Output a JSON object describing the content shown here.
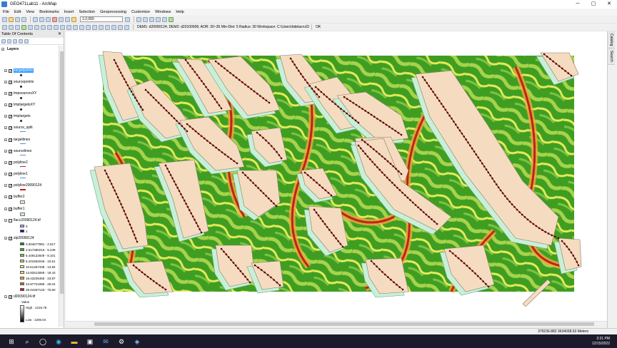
{
  "window": {
    "title": "GEO471Lab11 - ArcMap"
  },
  "menu": [
    "File",
    "Edit",
    "View",
    "Bookmarks",
    "Insert",
    "Selection",
    "Geoprocessing",
    "Customize",
    "Windows",
    "Help"
  ],
  "toolbar": {
    "scale": "1:2,060",
    "params": "DEM1: d20090124; DEM2: d20100606; AOR: 30~35 Min-Dist: 5 Radius: 30 Workspace: C:\\Users\\bdelacru\\D",
    "ok_label": "OK"
  },
  "toc": {
    "title": "Table Of Contents",
    "root": "Layers",
    "layers": [
      {
        "name": "targetpoints",
        "checked": true,
        "selected": true
      },
      {
        "name": "sourcepoints",
        "checked": true
      },
      {
        "name": "tmpsourcesXY",
        "checked": true
      },
      {
        "name": "tmptargetsXY",
        "checked": true
      },
      {
        "name": "tmptargets",
        "checked": true
      },
      {
        "name": "source_split",
        "checked": true
      },
      {
        "name": "targetlines",
        "checked": true
      },
      {
        "name": "sourcelines",
        "checked": true
      },
      {
        "name": "polyline2",
        "checked": true
      },
      {
        "name": "polyline1",
        "checked": true
      },
      {
        "name": "polyline20090124",
        "checked": true
      },
      {
        "name": "buffer2",
        "checked": true
      },
      {
        "name": "buffer1",
        "checked": true
      },
      {
        "name": "flacc20090124.tif",
        "checked": false
      },
      {
        "name": "slp20090124",
        "checked": true
      },
      {
        "name": "d20090124.tif",
        "checked": true
      },
      {
        "name": "d20100606.tif",
        "checked": false
      }
    ],
    "flacc_legend": [
      "0",
      "1"
    ],
    "slope_legend": [
      {
        "label": "0.004577891 - 2.517",
        "color": "#1f8a1f"
      },
      {
        "label": "2.517380216 - 5.449",
        "color": "#49a82e"
      },
      {
        "label": "5.449122929 - 8.101",
        "color": "#7cc443"
      },
      {
        "label": "8.101652049 - 10.61",
        "color": "#b0dc5a"
      },
      {
        "label": "10.61457438 - 13.82",
        "color": "#e5f07a"
      },
      {
        "label": "13.82513069 - 18.43",
        "color": "#f7e05a"
      },
      {
        "label": "18.43225465 - 23.87",
        "color": "#f4a83a"
      },
      {
        "label": "23.87721999 - 29.04",
        "color": "#e5602a"
      },
      {
        "label": "29.04267143 - 75.60",
        "color": "#c0211c"
      }
    ],
    "dem_legend": {
      "value": "Value",
      "high": "High : 1216.78",
      "low": "Low : 1206.04"
    }
  },
  "map": {
    "colors": {
      "green_dark": "#2f9a1c",
      "green_light": "#9ed04a",
      "yellow": "#e8ec58",
      "buffer": "#f5dcc0",
      "buffer_edge": "#c8f0d8",
      "line": "#c0221c",
      "point": "#3a1010"
    }
  },
  "status": {
    "coords": "379236.882  3634038.63 Meters"
  },
  "dock": [
    "Catalog",
    "Search"
  ],
  "taskbar": {
    "time": "3:31 PM",
    "date": "12/15/2022"
  }
}
